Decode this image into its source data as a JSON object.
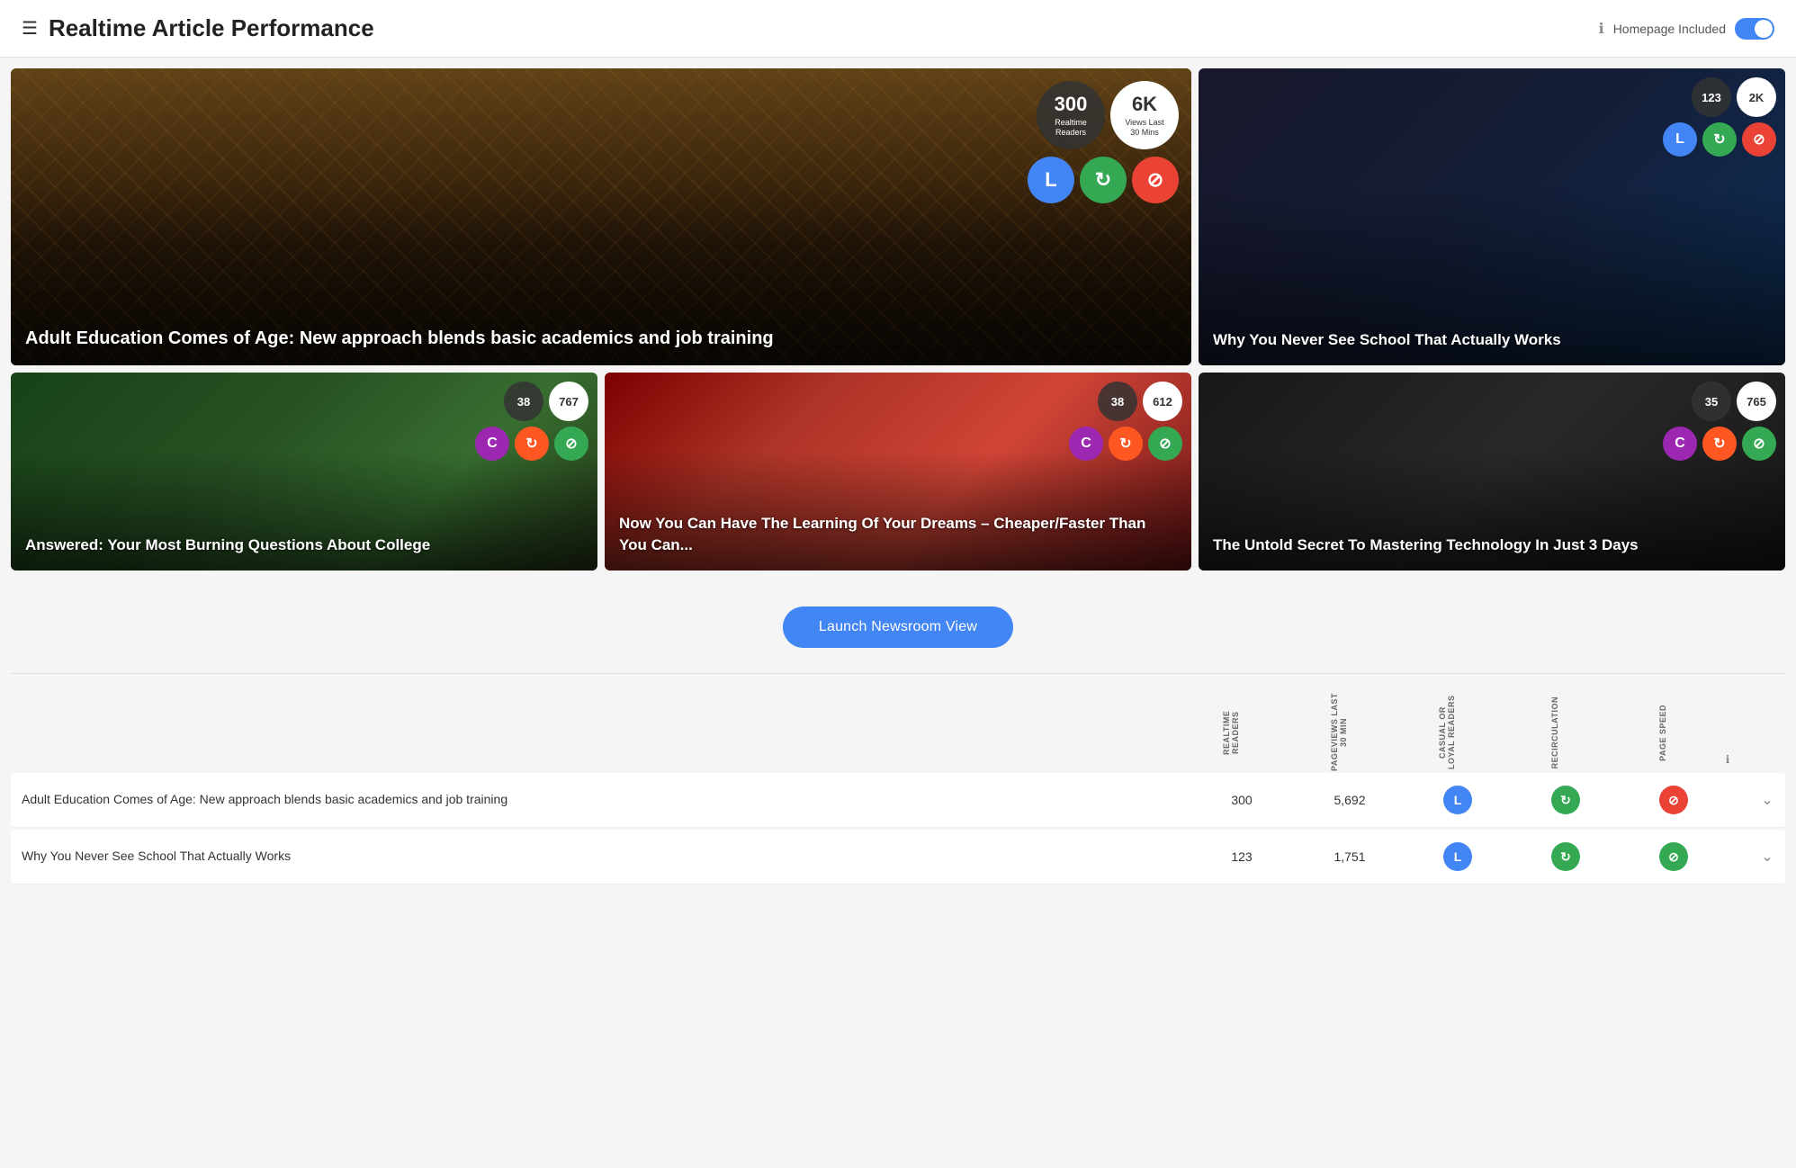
{
  "header": {
    "title": "Realtime Article Performance",
    "homepage_label": "Homepage Included",
    "toggle_on": true
  },
  "cards": [
    {
      "id": "card-1",
      "title": "Adult Education Comes of Age: New approach blends basic academics and job training",
      "large": true,
      "bg_class": "bg-bridge",
      "realtime_readers": "300",
      "realtime_readers_label": "Realtime\nReaders",
      "views_last_30": "6K",
      "views_last_30_label": "Views Last\n30 Mins",
      "icons": [
        "L",
        "↻",
        "⊘"
      ],
      "icon_colors": [
        "ic-blue",
        "ic-green",
        "ic-red"
      ]
    },
    {
      "id": "card-2",
      "title": "Why You Never See School That Actually Works",
      "large": false,
      "bg_class": "bg-desk",
      "realtime_readers": "123",
      "views_last_30": "2K",
      "icons": [
        "L",
        "↻",
        "⊘"
      ],
      "icon_colors": [
        "ic-blue",
        "ic-green",
        "ic-red"
      ]
    },
    {
      "id": "card-3",
      "title": "Answered: Your Most Burning Questions About College",
      "large": false,
      "bg_class": "bg-forest",
      "num1": "38",
      "num2": "767",
      "icons": [
        "C",
        "↻",
        "⊘"
      ],
      "icon_colors": [
        "ic-purple",
        "ic-orange",
        "ic-green"
      ]
    },
    {
      "id": "card-4",
      "title": "Now You Can Have The Learning Of Your Dreams – Cheaper/Faster Than You Can...",
      "large": false,
      "bg_class": "bg-strawberry",
      "num1": "38",
      "num2": "612",
      "icons": [
        "C",
        "↻",
        "⊘"
      ],
      "icon_colors": [
        "ic-purple",
        "ic-orange",
        "ic-green"
      ]
    },
    {
      "id": "card-5",
      "title": "The Untold Secret To Mastering Technology In Just 3 Days",
      "large": false,
      "bg_class": "bg-dark",
      "num1": "35",
      "num2": "765",
      "icons": [
        "C",
        "↻",
        "⊘"
      ],
      "icon_colors": [
        "ic-purple",
        "ic-orange",
        "ic-green"
      ]
    }
  ],
  "launch_button": "Launch Newsroom View",
  "table": {
    "columns": [
      "REALTIME READERS",
      "PAGEVIEWS LAST 30 MIN",
      "CASUAL OR LOYAL READERS",
      "RECIRCULATION",
      "PAGE SPEED"
    ],
    "rows": [
      {
        "title": "Adult Education Comes of Age: New approach blends basic academics and job training",
        "realtime": "300",
        "pageviews": "5,692",
        "loyal_icon": "L",
        "loyal_color": "ic-blue",
        "recirc_icon": "↻",
        "recirc_color": "ic-green",
        "speed_icon": "⊘",
        "speed_color": "ic-red",
        "expanded": false
      },
      {
        "title": "Why You Never See School That Actually Works",
        "realtime": "123",
        "pageviews": "1,751",
        "loyal_icon": "L",
        "loyal_color": "ic-blue",
        "recirc_icon": "↻",
        "recirc_color": "ic-green",
        "speed_icon": "⊘",
        "speed_color": "ic-green",
        "expanded": false
      }
    ]
  }
}
